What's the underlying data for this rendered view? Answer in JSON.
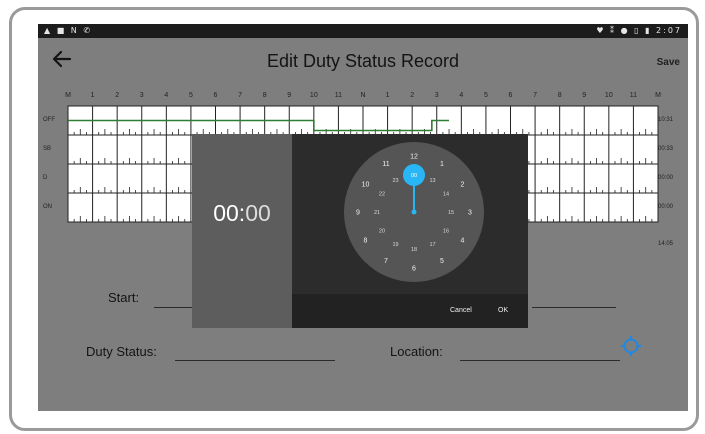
{
  "status_bar": {
    "left_icons": "▲ ■ N ✆",
    "right_icons": "♥ ⁑ ● ▯ ▮",
    "time": "2:07"
  },
  "app_bar": {
    "back_icon": "arrow-left-icon",
    "title": "Edit Duty Status Record",
    "save_label": "Save"
  },
  "log_grid": {
    "hour_labels": [
      "M",
      "1",
      "2",
      "3",
      "4",
      "5",
      "6",
      "7",
      "8",
      "9",
      "10",
      "11",
      "N",
      "1",
      "2",
      "3",
      "4",
      "5",
      "6",
      "7",
      "8",
      "9",
      "10",
      "11",
      "M"
    ],
    "rows": [
      {
        "label": "OFF",
        "total": "10:31"
      },
      {
        "label": "SB",
        "total": "00:33"
      },
      {
        "label": "D",
        "total": "00:00"
      },
      {
        "label": "ON",
        "total": "00:00"
      }
    ],
    "grand_total": "14:05",
    "status_line_color": "#2e7d32"
  },
  "form": {
    "start_label": "Start:",
    "duty_status_label": "Duty Status:",
    "duty_status_value": "",
    "location_label": "Location:",
    "location_value": "",
    "location_icon": "crosshair-target-icon",
    "location_icon_color": "#1e88e5"
  },
  "time_picker": {
    "hours": "00",
    "separator": ":",
    "minutes": "00",
    "outer_numbers": [
      "12",
      "1",
      "2",
      "3",
      "4",
      "5",
      "6",
      "7",
      "8",
      "9",
      "10",
      "11"
    ],
    "inner_numbers": [
      "00",
      "13",
      "14",
      "15",
      "16",
      "17",
      "18",
      "19",
      "20",
      "21",
      "22",
      "23"
    ],
    "selected": "00",
    "accent_color": "#29b6f6",
    "cancel_label": "Cancel",
    "ok_label": "OK"
  }
}
